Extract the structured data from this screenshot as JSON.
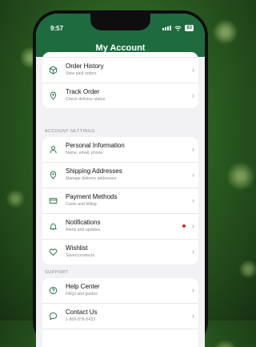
{
  "status_bar": {
    "time": "9:57",
    "battery": "83"
  },
  "header": {
    "title": "My Account"
  },
  "orders": {
    "items": [
      {
        "label": "Order History",
        "sub": "View past orders",
        "icon": "package-icon"
      },
      {
        "label": "Track Order",
        "sub": "Check delivery status",
        "icon": "location-pin-icon"
      }
    ]
  },
  "account_settings": {
    "heading": "ACCOUNT SETTINGS",
    "items": [
      {
        "label": "Personal Information",
        "sub": "Name, email, phone",
        "icon": "person-icon"
      },
      {
        "label": "Shipping Addresses",
        "sub": "Manage delivery addresses",
        "icon": "location-pin-icon"
      },
      {
        "label": "Payment Methods",
        "sub": "Cards and billing",
        "icon": "credit-card-icon"
      },
      {
        "label": "Notifications",
        "sub": "Alerts and updates",
        "icon": "bell-icon",
        "unread": true
      },
      {
        "label": "Wishlist",
        "sub": "Saved products",
        "icon": "heart-icon"
      }
    ]
  },
  "support": {
    "heading": "SUPPORT",
    "items": [
      {
        "label": "Help Center",
        "sub": "FAQs and guides",
        "icon": "help-circle-icon"
      },
      {
        "label": "Contact Us",
        "sub": "1-800-876-5433",
        "icon": "chat-bubble-icon"
      }
    ]
  },
  "colors": {
    "accent": "#1e6b40",
    "badge": "#e0262b",
    "background": "#f2f2f4"
  }
}
